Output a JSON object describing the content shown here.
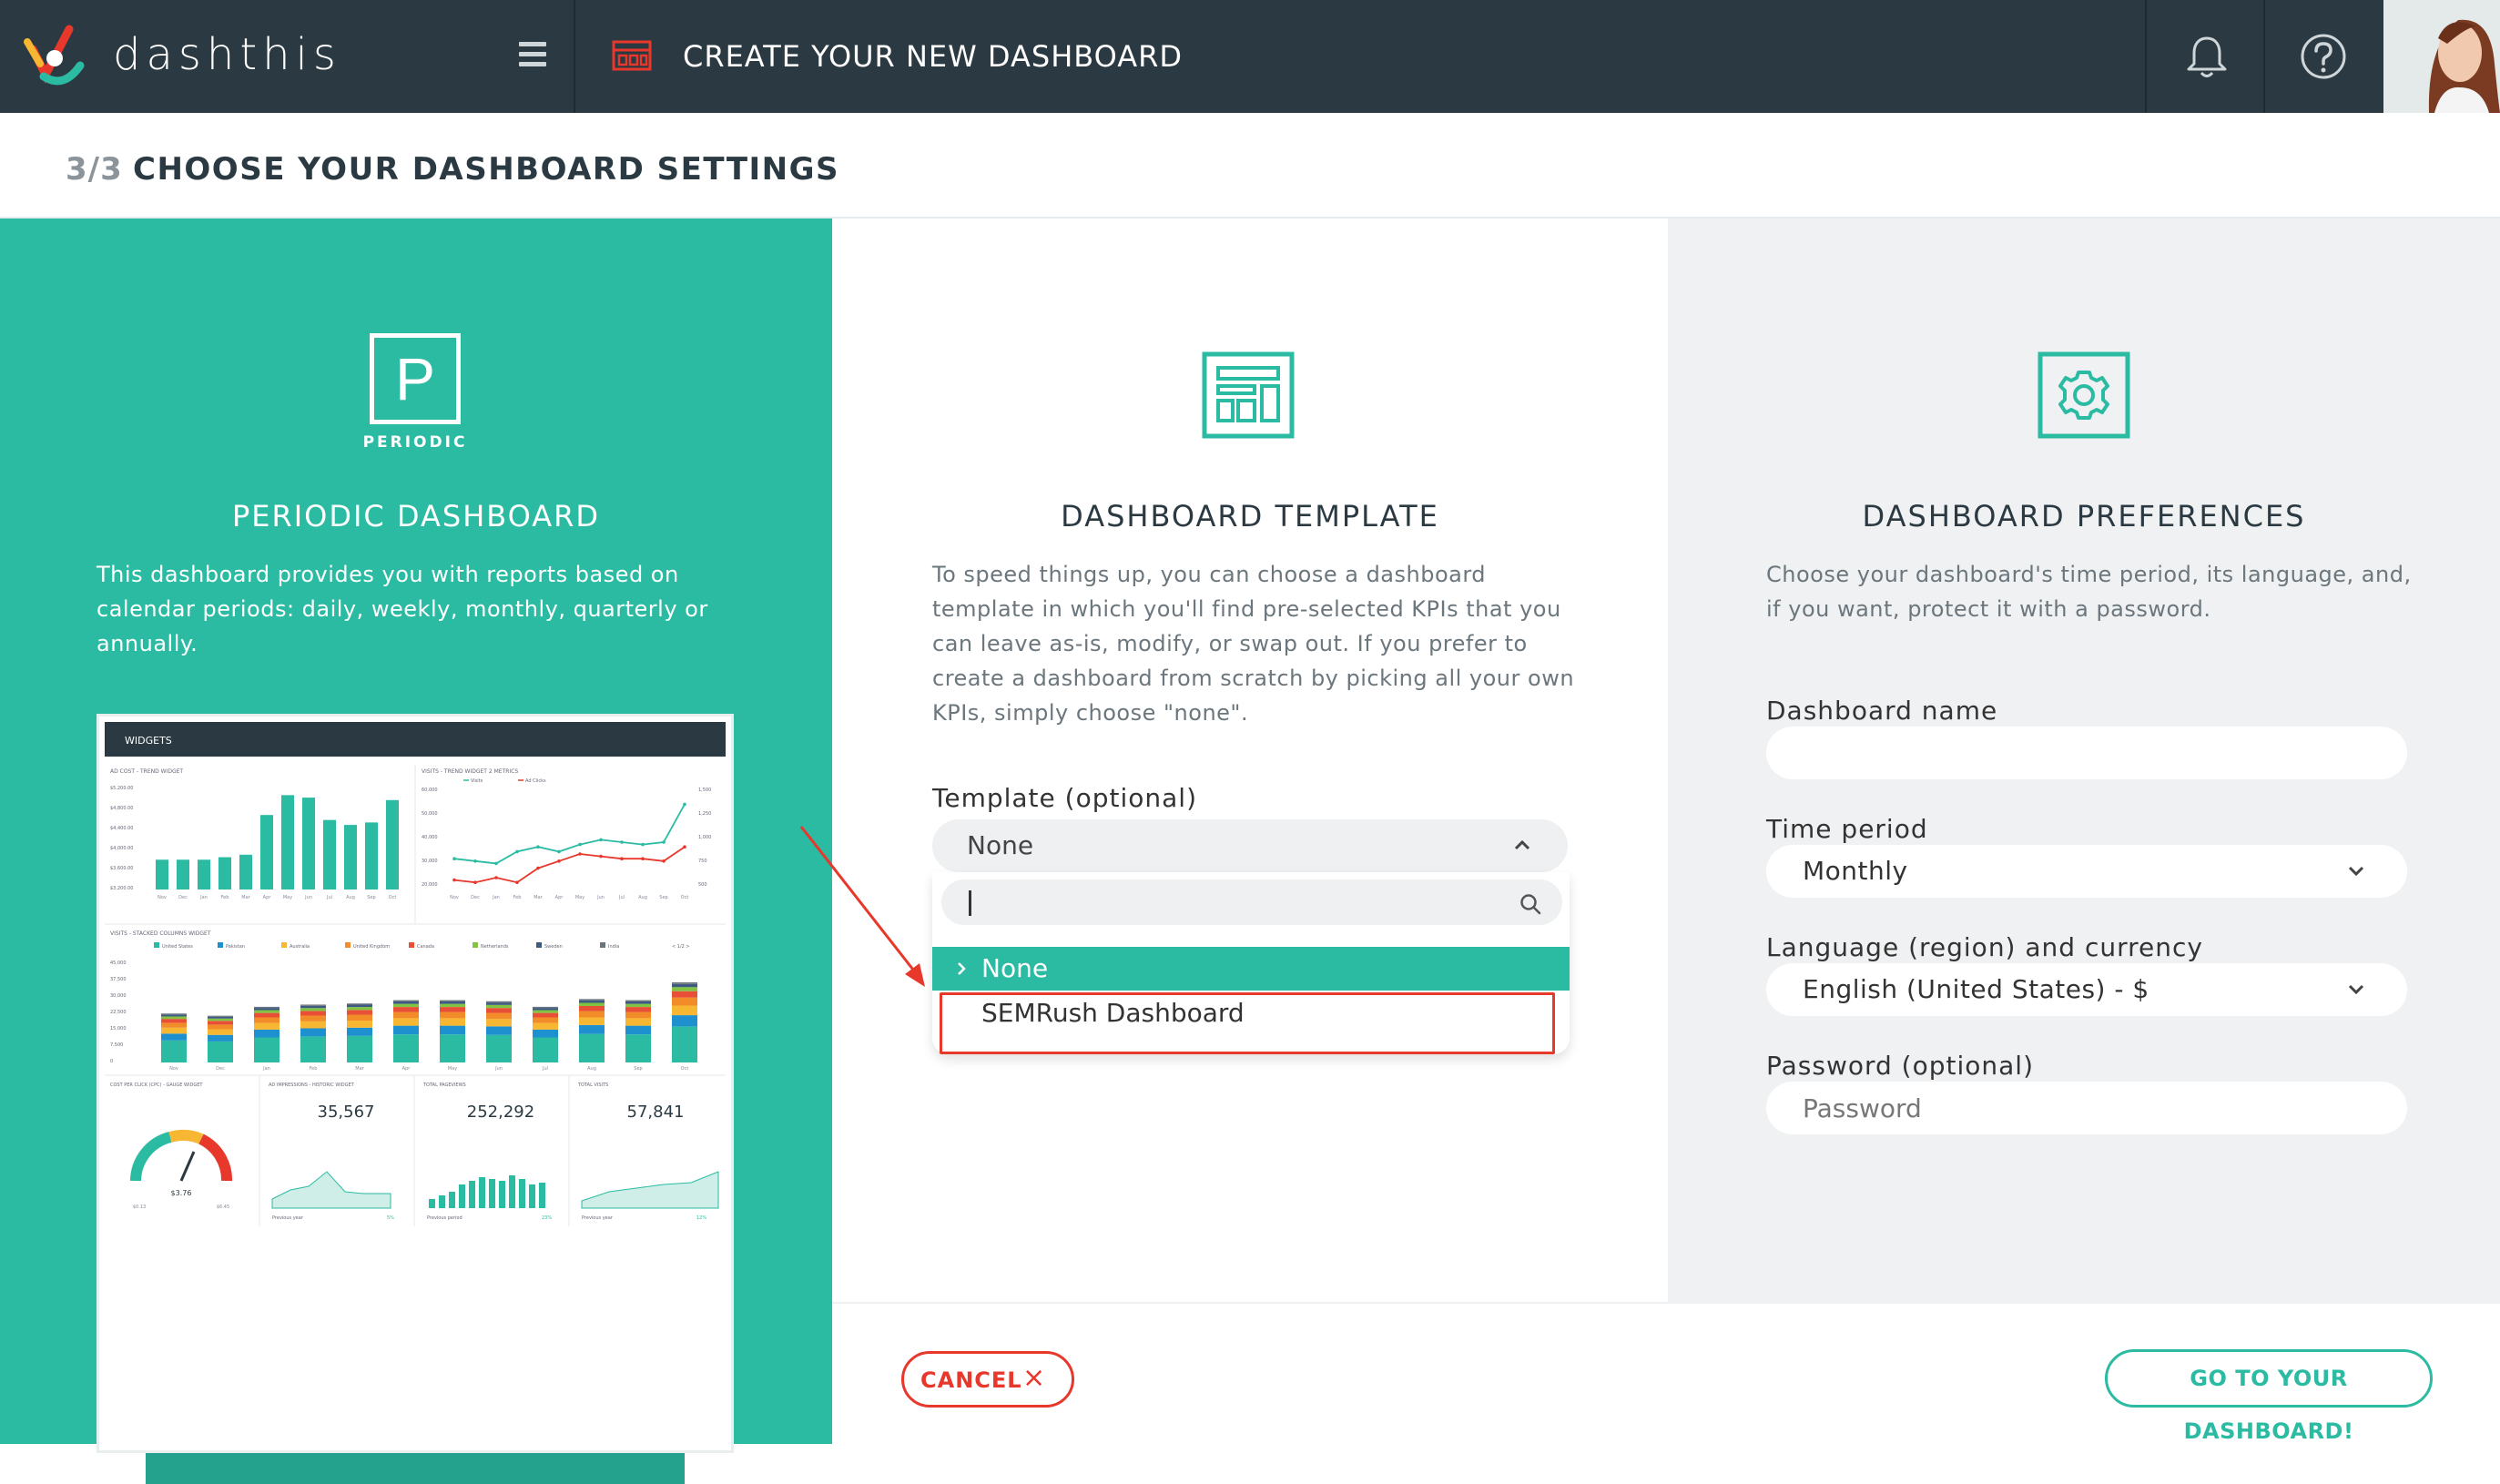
{
  "app": {
    "brand": "dashthis"
  },
  "topbar": {
    "title": "CREATE YOUR NEW DASHBOARD",
    "icons": [
      "logo-icon",
      "hamburger-menu-icon",
      "dashboard-layout-icon",
      "bell-icon",
      "help-icon",
      "user-avatar"
    ]
  },
  "step": {
    "number": "3/3",
    "title": "CHOOSE YOUR DASHBOARD SETTINGS"
  },
  "periodic": {
    "icon_letter": "P",
    "icon_label": "PERIODIC",
    "heading": "PERIODIC DASHBOARD",
    "description": "This dashboard provides you with reports based on calendar periods: daily, weekly, monthly, quarterly or annually."
  },
  "template": {
    "heading": "DASHBOARD TEMPLATE",
    "description": "To speed things up, you can choose a dashboard template in which you'll find pre-selected KPIs that you can leave as-is, modify, or swap out. If you prefer to create a dashboard from scratch by picking all your own KPIs, simply choose \"none\".",
    "label": "Template (optional)",
    "selected": "None",
    "search_value": "",
    "options": [
      "None",
      "SEMRush Dashboard"
    ]
  },
  "preferences": {
    "heading": "DASHBOARD PREFERENCES",
    "description": "Choose your dashboard's time period, its language, and, if you want, protect it with a password.",
    "name_label": "Dashboard name",
    "name_value": "",
    "period_label": "Time period",
    "period_value": "Monthly",
    "language_label": "Language (region) and currency",
    "language_value": "English (United States) - $",
    "password_label": "Password (optional)",
    "password_placeholder": "Password"
  },
  "footer": {
    "cancel_label": "CANCEL",
    "cancel_icon": "×",
    "go_label": "GO TO YOUR DASHBOARD!"
  },
  "colors": {
    "brand_teal": "#2bbba3",
    "topbar": "#2b3a42",
    "danger": "#e8372b",
    "prefs_bg": "#f0f1f2"
  },
  "preview": {
    "header": "WIDGETS",
    "widgets": [
      {
        "title": "AD COST - TREND WIDGET"
      },
      {
        "title": "VISITS - TREND WIDGET 2 METRICS",
        "legend": [
          "Visits",
          "Ad Clicks"
        ]
      },
      {
        "title": "VISITS - STACKED COLUMNS WIDGET",
        "legend": [
          "United States",
          "Pakistan",
          "Australia",
          "United Kingdom",
          "Canada",
          "Netherlands",
          "Sweden",
          "India",
          "< 1/2 >"
        ]
      },
      {
        "title": "COST PER CLICK (CPC) - GAUGE WIDGET",
        "value": "$3.76",
        "min": "$0.13",
        "max": "$6.45"
      },
      {
        "title": "AD IMPRESSIONS - HISTORIC WIDGET",
        "value": "35,567",
        "compare": "Previous year",
        "change": "5%"
      },
      {
        "title": "TOTAL PAGEVIEWS",
        "value": "252,292",
        "compare": "Previous period",
        "change": "23%"
      },
      {
        "title": "TOTAL VISITS",
        "value": "57,841",
        "compare": "Previous year",
        "change": "12%"
      }
    ],
    "cost_axis": [
      "$5,200.00",
      "$4,800.00",
      "$4,400.00",
      "$4,000.00",
      "$3,600.00",
      "$3,200.00"
    ],
    "visits_axis_left": [
      "60,000",
      "50,000",
      "40,000",
      "30,000",
      "20,000"
    ],
    "visits_axis_right": [
      "1,500",
      "1,250",
      "1,000",
      "750",
      "500"
    ],
    "stack_axis": [
      "45,000",
      "37,500",
      "30,000",
      "22,500",
      "15,000",
      "7,500",
      "0"
    ],
    "months_trend": [
      "Nov",
      "Dec",
      "Jan",
      "Feb",
      "Mar",
      "Apr",
      "May",
      "Jun",
      "Jul",
      "Aug",
      "Sep",
      "Oct"
    ],
    "cost_values": [
      3800,
      3800,
      3800,
      3850,
      3900,
      4700,
      5100,
      5050,
      4600,
      4500,
      4550,
      5000
    ],
    "visits_line": [
      33,
      32,
      31,
      36,
      38,
      36,
      39,
      41,
      40,
      39,
      40,
      56
    ],
    "clicks_line": [
      24,
      23,
      25,
      23,
      29,
      32,
      35,
      34,
      33,
      33,
      32,
      38
    ],
    "stack_months": [
      "Nov",
      "Dec",
      "Jan",
      "Feb",
      "Mar",
      "Apr",
      "May",
      "Jun",
      "Jul",
      "Aug",
      "Sep",
      "Oct"
    ],
    "stack_totals": [
      22000,
      21000,
      25000,
      26000,
      26500,
      28000,
      28000,
      27500,
      25000,
      28500,
      28000,
      36000
    ],
    "stack_colors": [
      "#2bbba3",
      "#1e8fcf",
      "#f7b733",
      "#f28c28",
      "#e94f37",
      "#82c341",
      "#3d5a80",
      "#6c757d"
    ]
  }
}
